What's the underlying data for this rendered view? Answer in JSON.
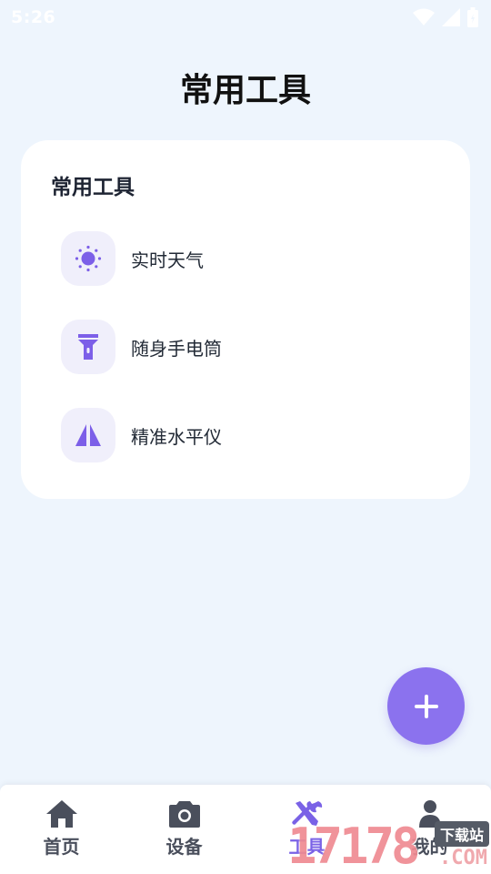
{
  "status_bar": {
    "time": "5:26",
    "icons": [
      "wifi-icon",
      "signal-icon",
      "battery-icon"
    ]
  },
  "header": {
    "title": "常用工具"
  },
  "tools_card": {
    "title": "常用工具",
    "items": [
      {
        "label": "实时天气",
        "icon": "sun-icon"
      },
      {
        "label": "随身手电筒",
        "icon": "flashlight-icon"
      },
      {
        "label": "精准水平仪",
        "icon": "level-icon"
      }
    ]
  },
  "fab": {
    "icon": "plus-icon"
  },
  "bottom_nav": {
    "items": [
      {
        "label": "首页",
        "icon": "home-icon"
      },
      {
        "label": "设备",
        "icon": "camera-icon"
      },
      {
        "label": "工具",
        "icon": "tools-icon",
        "active": true
      },
      {
        "label": "我的",
        "icon": "person-icon"
      }
    ]
  },
  "watermark": {
    "digits": "17178",
    "tag": "下载站",
    "domain": ".COM"
  },
  "colors": {
    "background": "#eef5fd",
    "accent": "#8b72ee",
    "active_nav": "#7a62e6",
    "icon_bg": "#f0effb"
  }
}
